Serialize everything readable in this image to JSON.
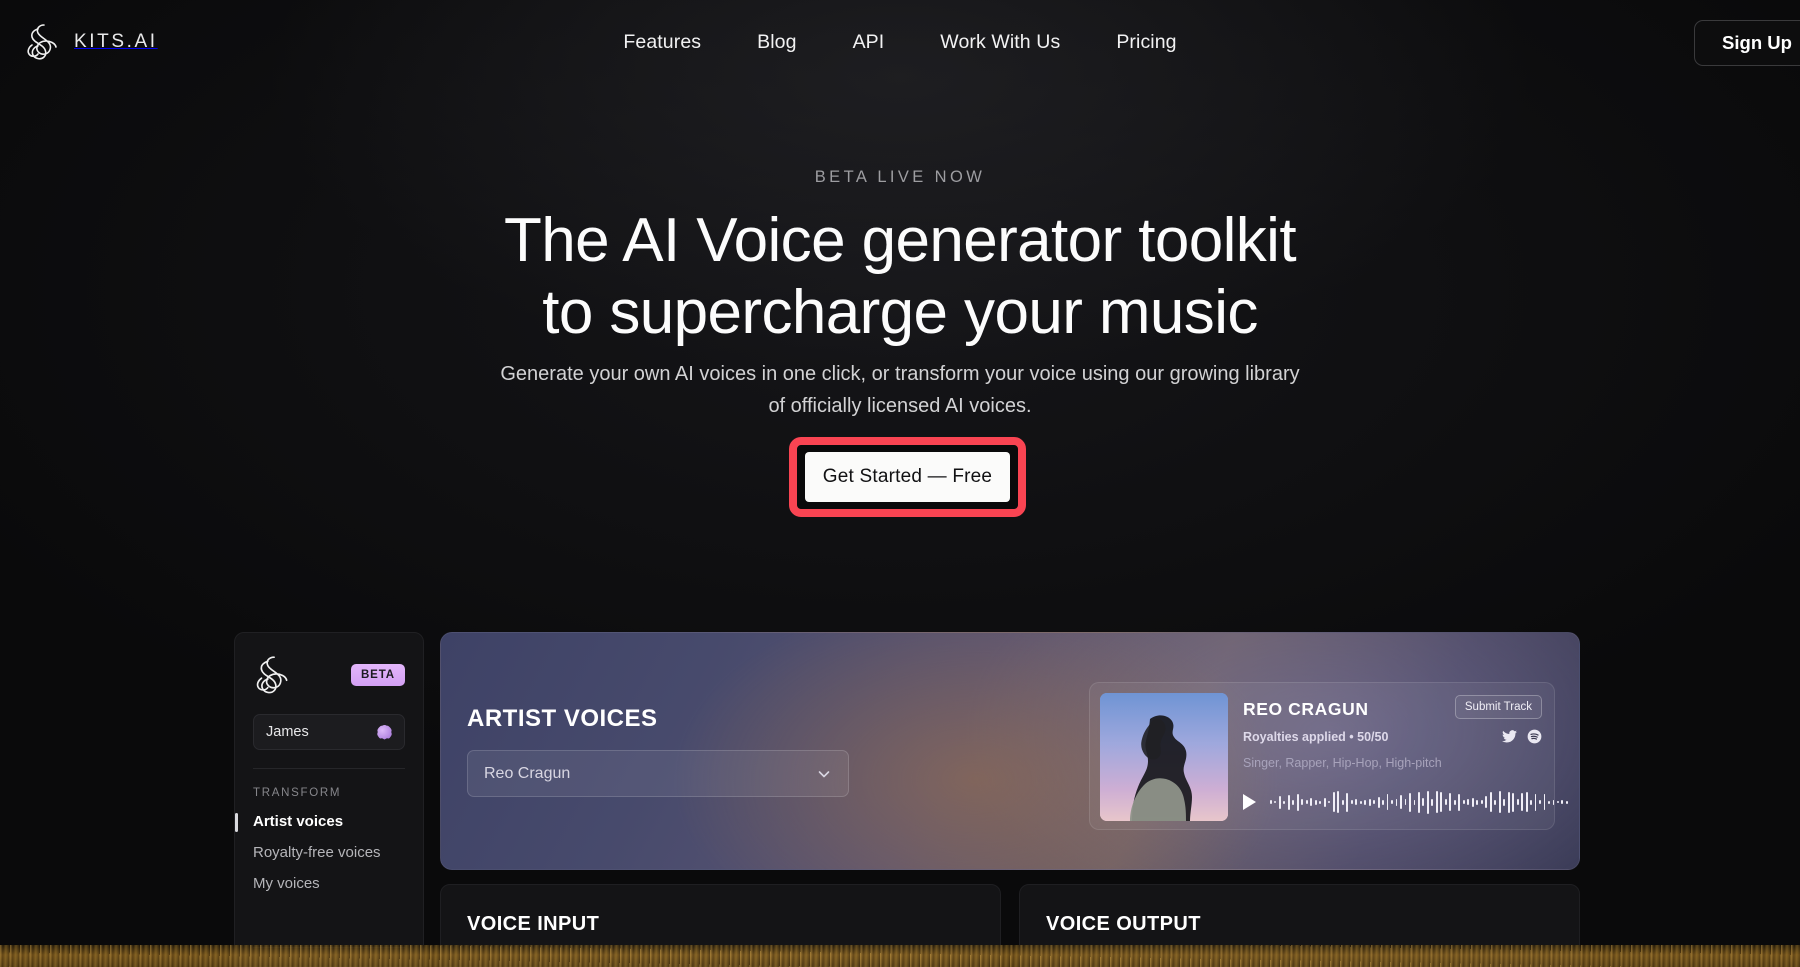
{
  "brand": {
    "name": "KITS.AI",
    "logo_icon": "kits-swirl-logo-icon"
  },
  "nav": {
    "links": [
      {
        "label": "Features"
      },
      {
        "label": "Blog"
      },
      {
        "label": "API"
      },
      {
        "label": "Work With Us"
      },
      {
        "label": "Pricing"
      }
    ],
    "signup_label": "Sign Up"
  },
  "hero": {
    "eyebrow": "BETA LIVE NOW",
    "headline_line1": "The AI Voice generator toolkit",
    "headline_line2": "to supercharge your music",
    "subhead": "Generate your own AI voices in one click, or transform your voice using our growing library of officially licensed AI voices.",
    "cta_label": "Get Started — Free",
    "highlight_color": "#f94452"
  },
  "app_preview": {
    "sidebar": {
      "logo_icon": "kits-swirl-logo-icon",
      "badge": "BETA",
      "badge_color": "#d3a0f3",
      "user_name": "James",
      "avatar_icon": "user-avatar-icon",
      "section_label": "TRANSFORM",
      "items": [
        {
          "label": "Artist voices",
          "active": true
        },
        {
          "label": "Royalty-free voices",
          "active": false
        },
        {
          "label": "My voices",
          "active": false
        }
      ]
    },
    "hero_panel": {
      "title": "ARTIST VOICES",
      "voice_select_value": "Reo Cragun",
      "chevron_icon": "chevron-down-icon",
      "track": {
        "name": "REO CRAGUN",
        "royalties": "Royalties applied • 50/50",
        "tags": "Singer, Rapper, Hip-Hop, High-pitch",
        "submit_label": "Submit Track",
        "socials": [
          "twitter-icon",
          "spotify-icon"
        ],
        "play_icon": "play-icon",
        "waveform": [
          4,
          2,
          13,
          3,
          15,
          5,
          17,
          6,
          4,
          8,
          5,
          3,
          9,
          2,
          20,
          22,
          5,
          19,
          4,
          6,
          3,
          5,
          7,
          4,
          11,
          5,
          16,
          4,
          7,
          14,
          6,
          19,
          5,
          21,
          8,
          23,
          7,
          22,
          20,
          6,
          18,
          5,
          17,
          4,
          6,
          9,
          5,
          4,
          12,
          20,
          5,
          22,
          7,
          21,
          19,
          6,
          18,
          20,
          5,
          17,
          4,
          16,
          3,
          5,
          2,
          4,
          3
        ]
      }
    },
    "voice_input_title": "VOICE INPUT",
    "voice_output_title": "VOICE OUTPUT"
  }
}
